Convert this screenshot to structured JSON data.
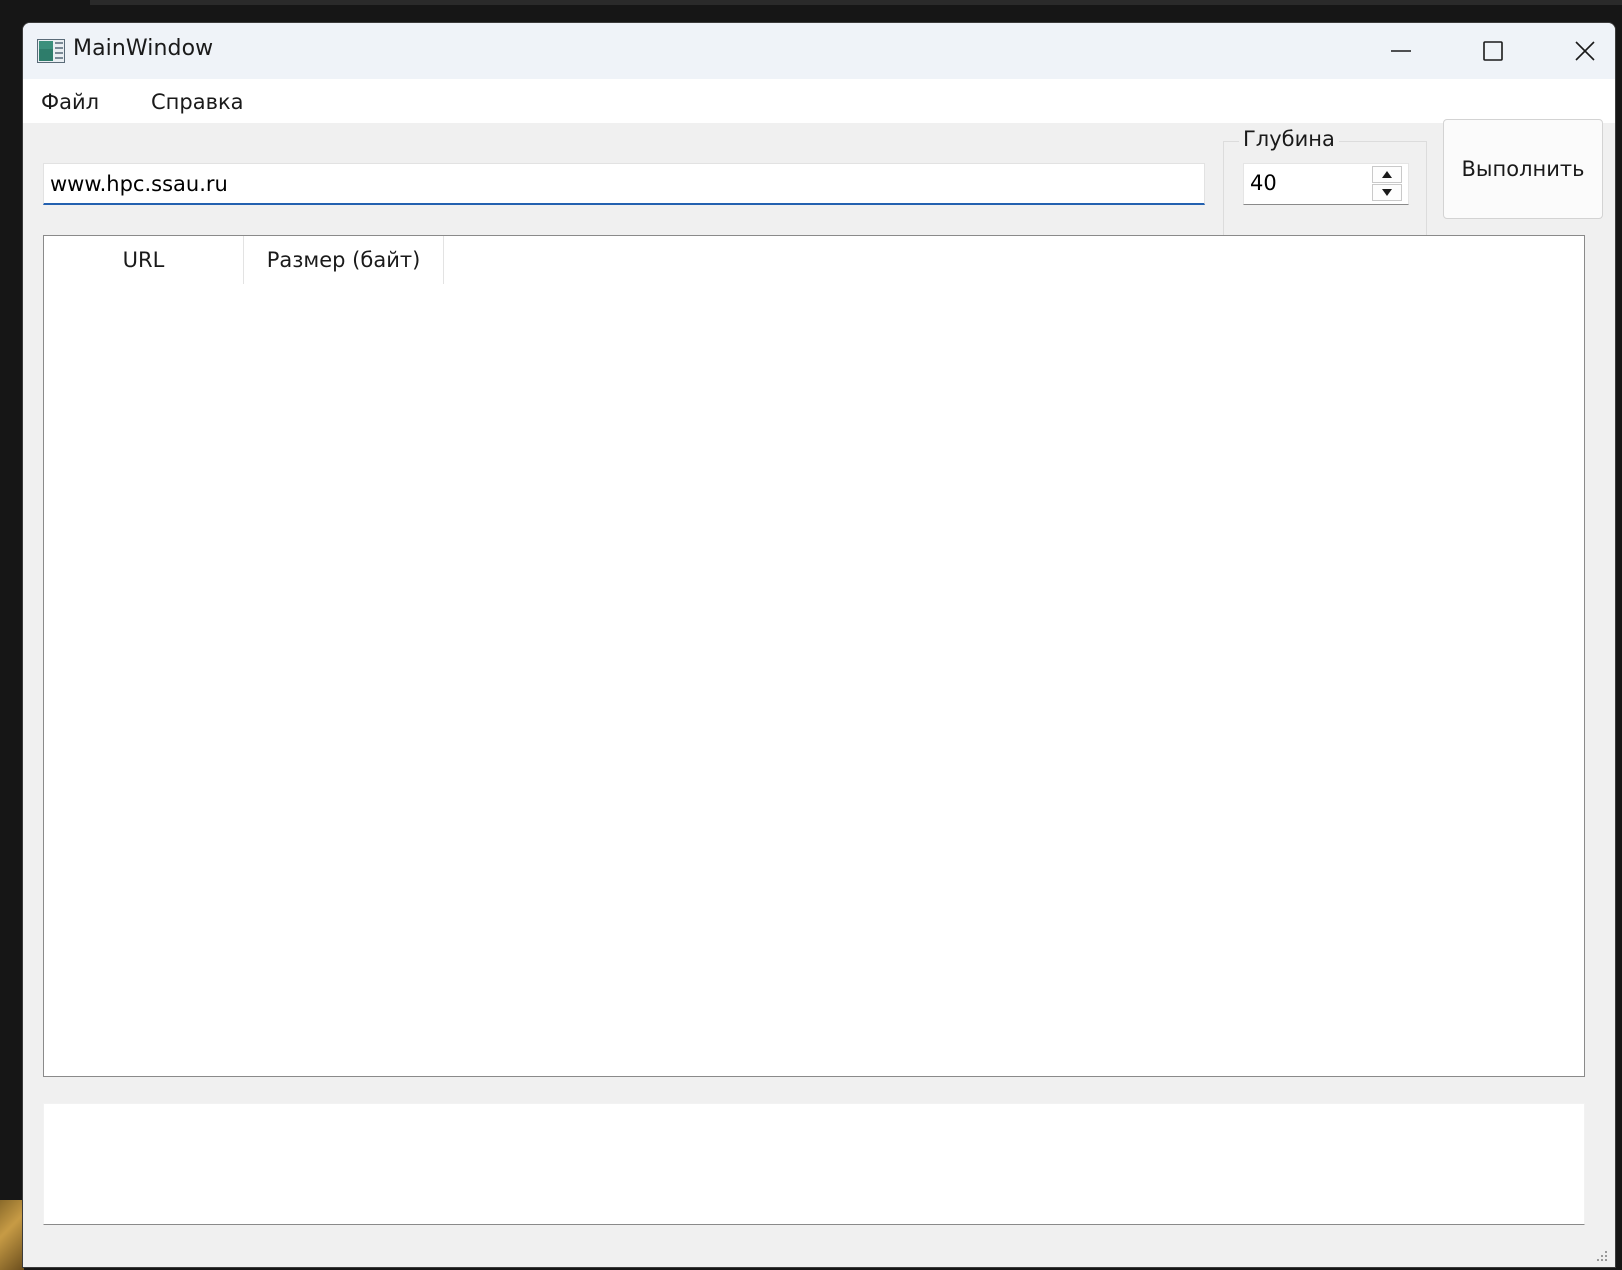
{
  "window": {
    "title": "MainWindow",
    "controls": [
      "minimize-icon",
      "maximize-icon",
      "close-icon"
    ]
  },
  "menu": {
    "items": [
      {
        "label": "Файл"
      },
      {
        "label": "Справка"
      }
    ]
  },
  "form": {
    "url_value": "www.hpc.ssau.ru",
    "depth_label": "Глубина",
    "depth_value": "40",
    "run_button_label": "Выполнить"
  },
  "table": {
    "columns": [
      "URL",
      "Размер (байт)"
    ],
    "rows": []
  },
  "log": {
    "text": ""
  },
  "colors": {
    "focus_accent": "#2461b0",
    "window_bg": "#f0f0f0",
    "titlebar_bg": "#eff3f8"
  }
}
